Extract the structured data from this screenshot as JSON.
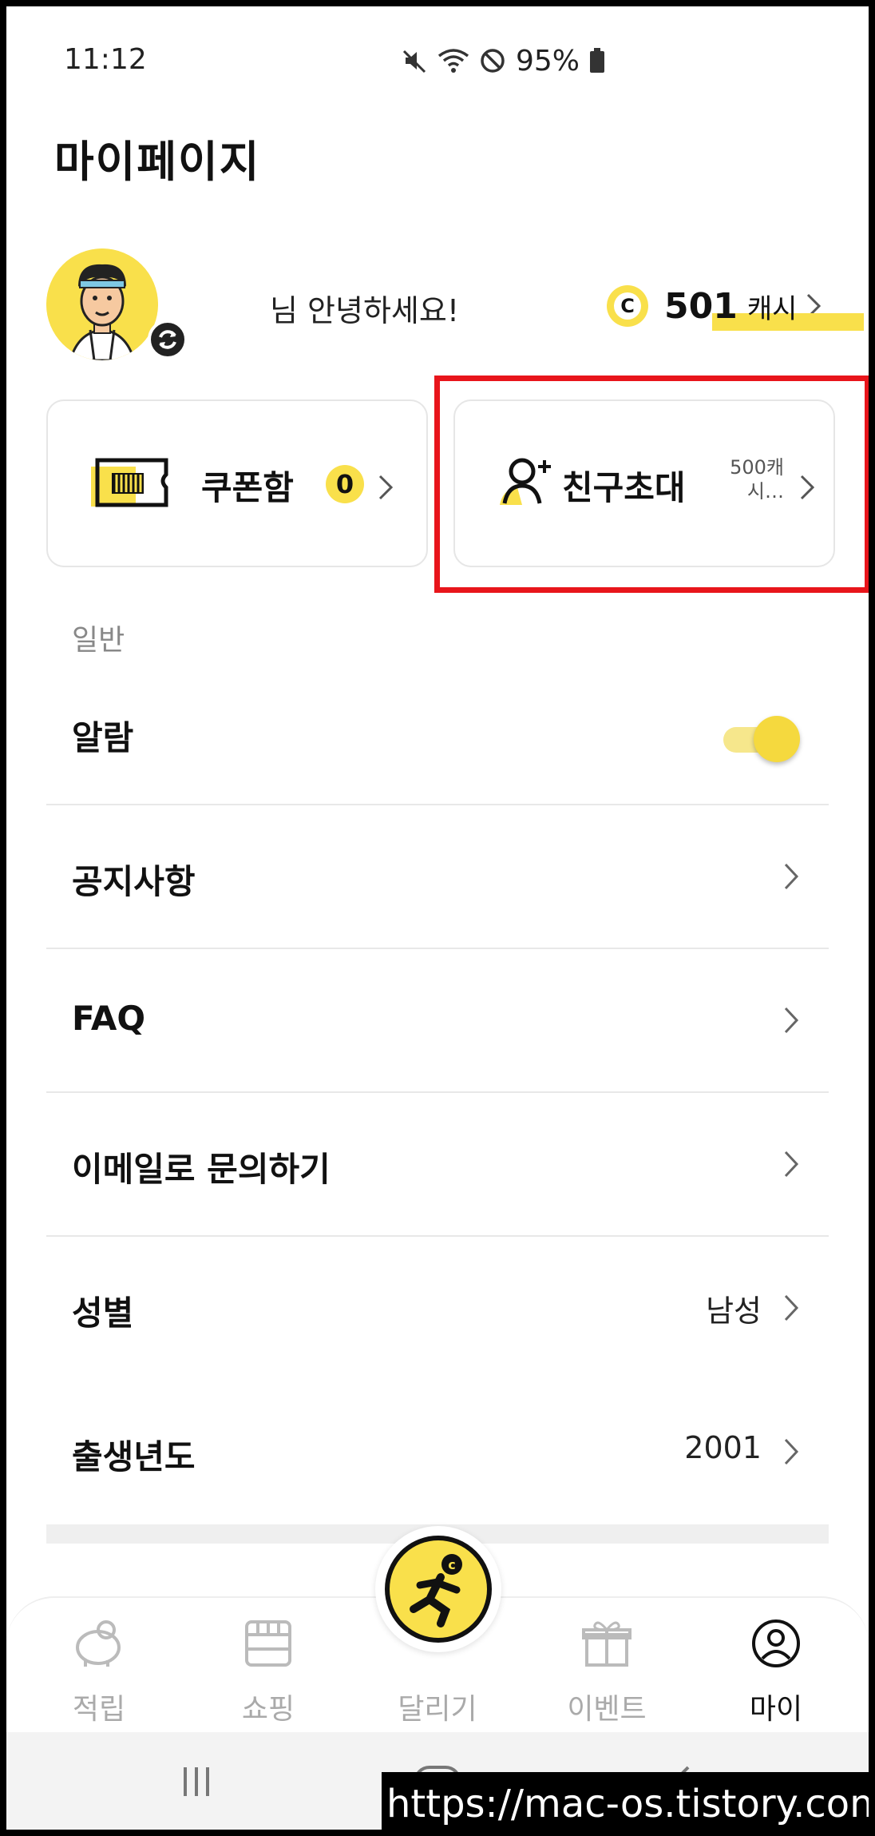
{
  "status_bar": {
    "time": "11:12",
    "battery": "95%",
    "icons": [
      "mute-icon",
      "wifi-icon",
      "dnd-icon",
      "battery-icon"
    ]
  },
  "page": {
    "title": "마이페이지"
  },
  "profile": {
    "greeting": "님 안녕하세요!",
    "cash_amount": "501",
    "cash_unit": "캐시",
    "coin_letter": "C"
  },
  "cards": {
    "coupon": {
      "label": "쿠폰함",
      "count": "0"
    },
    "invite": {
      "label": "친구초대",
      "reward_line1": "500캐",
      "reward_line2": "시…"
    }
  },
  "section": {
    "general": "일반"
  },
  "settings": [
    {
      "label": "알람",
      "toggle_on": true
    },
    {
      "label": "공지사항"
    },
    {
      "label": "FAQ"
    },
    {
      "label": "이메일로 문의하기"
    },
    {
      "label": "성별",
      "value": "남성"
    },
    {
      "label": "출생년도",
      "value": "2001"
    }
  ],
  "bottom_nav": [
    {
      "label": "적립",
      "icon": "piggy-bank-icon"
    },
    {
      "label": "쇼핑",
      "icon": "store-icon"
    },
    {
      "label": "달리기",
      "icon": "runner-icon"
    },
    {
      "label": "이벤트",
      "icon": "gift-icon"
    },
    {
      "label": "마이",
      "icon": "user-circle-icon",
      "active": true
    }
  ],
  "colors": {
    "accent_yellow": "#f9e04b",
    "highlight_red": "#e8151b"
  },
  "watermark": "https://mac-os.tistory.com"
}
